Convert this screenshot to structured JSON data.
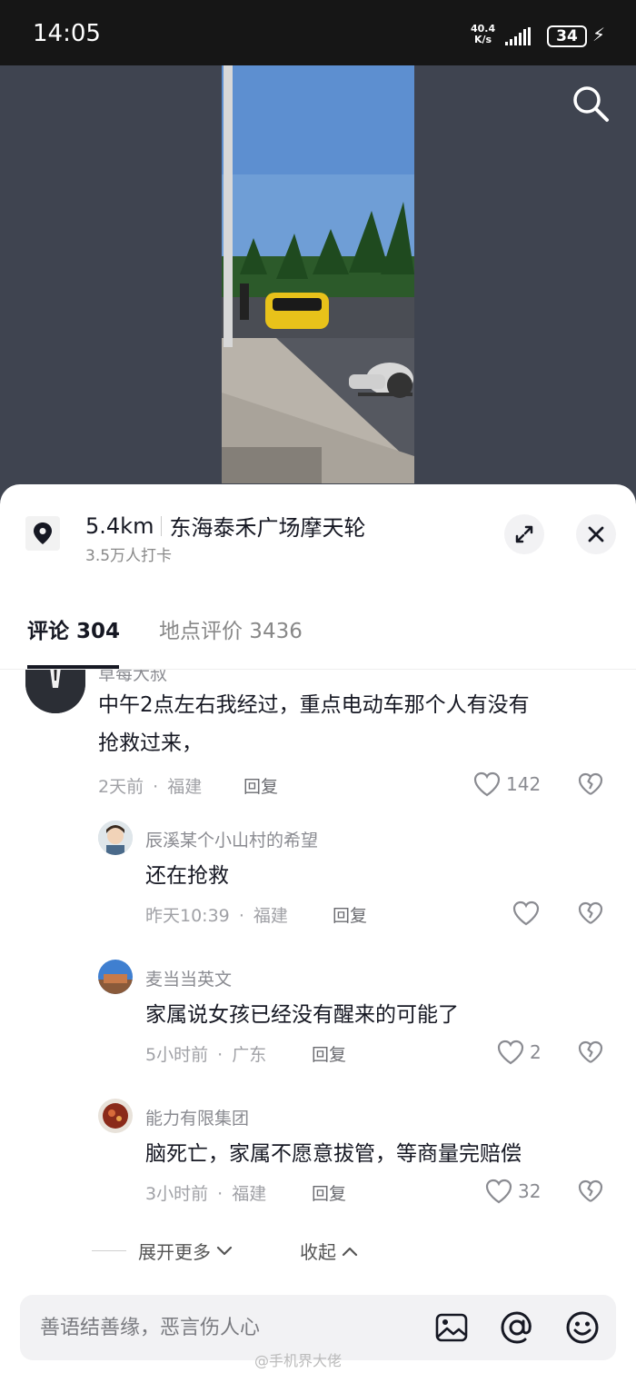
{
  "status_bar": {
    "time": "14:05",
    "net_speed_value": "40.4",
    "net_speed_unit": "K/s",
    "battery": "34"
  },
  "location": {
    "distance": "5.4km",
    "name": "东海泰禾广场摩天轮",
    "checkins": "3.5万人打卡"
  },
  "tabs": [
    {
      "label": "评论 304",
      "active": true
    },
    {
      "label": "地点评价 3436",
      "active": false
    }
  ],
  "comments": [
    {
      "name": "草莓大叔",
      "text_line1": "中午2点左右我经过，重点电动车那个人有没有",
      "text_line2": "抢救过来，",
      "time": "2天前",
      "region": "福建",
      "reply": "回复",
      "likes": "142"
    },
    {
      "name": "辰溪某个小山村的希望",
      "text": "还在抢救",
      "time": "昨天10:39",
      "region": "福建",
      "reply": "回复",
      "likes": ""
    },
    {
      "name": "麦当当英文",
      "text": "家属说女孩已经没有醒来的可能了",
      "time": "5小时前",
      "region": "广东",
      "reply": "回复",
      "likes": "2"
    },
    {
      "name": "能力有限集团",
      "text": "脑死亡，家属不愿意拔管，等商量完赔偿",
      "time": "3小时前",
      "region": "福建",
      "reply": "回复",
      "likes": "32"
    }
  ],
  "meta_separator": "·",
  "expand": {
    "more": "展开更多",
    "collapse": "收起"
  },
  "input": {
    "placeholder": "善语结善缘，恶言伤人心"
  },
  "watermark": "@手机界大佬",
  "colors": {
    "sheet_bg": "#ffffff",
    "video_bg": "#3f4450",
    "text_primary": "#161823",
    "text_secondary": "#8a8b91"
  }
}
